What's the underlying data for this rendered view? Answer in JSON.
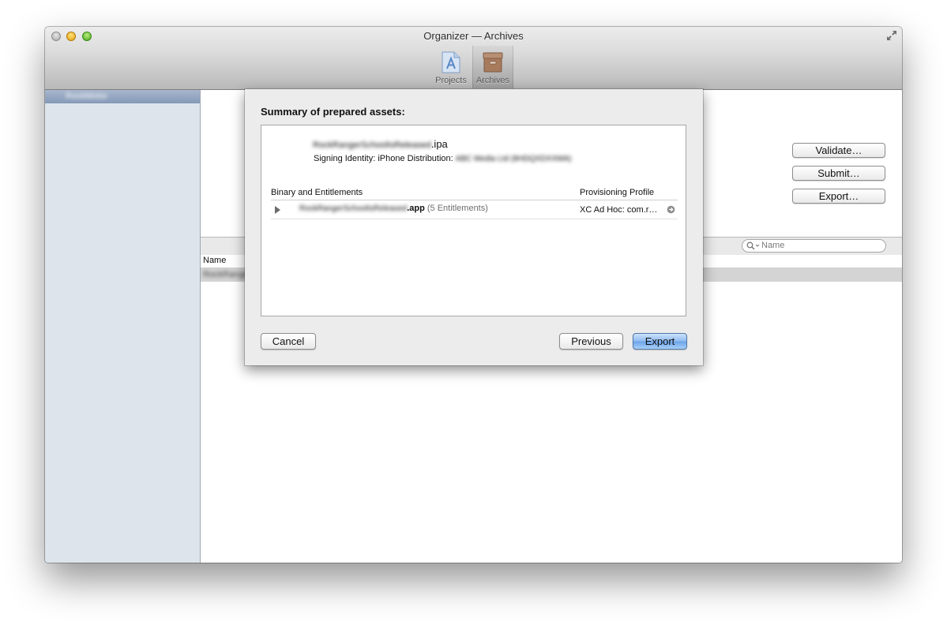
{
  "window": {
    "title": "Organizer — Archives",
    "toolbar": [
      {
        "label": "Projects",
        "icon": "projects-icon",
        "selected": false
      },
      {
        "label": "Archives",
        "icon": "archives-icon",
        "selected": true
      }
    ]
  },
  "sidebar": {
    "selected_item": "RockMotor"
  },
  "main": {
    "buttons": {
      "validate": "Validate…",
      "submit": "Submit…",
      "export": "Export…"
    },
    "search": {
      "placeholder": "Name"
    },
    "column_name": "Name",
    "row_name": "RockRange"
  },
  "sheet": {
    "title": "Summary of prepared assets:",
    "ipa_name_blurred": "RockRangerSchoolIsReleased",
    "ipa_ext": ".ipa",
    "signing_label": "Signing Identity: iPhone Distribution:",
    "signing_value_blurred": "ABC Media Ltd (8HDQXDXXMA)",
    "table_headers": {
      "binary": "Binary and Entitlements",
      "profile": "Provisioning Profile"
    },
    "row": {
      "app_name_blurred": "RockRangerSchoolIsReleased",
      "app_ext": ".app",
      "entitlements": "(5 Entitlements)",
      "profile": "XC Ad Hoc: com.r…"
    },
    "buttons": {
      "cancel": "Cancel",
      "previous": "Previous",
      "export": "Export"
    }
  },
  "colors": {
    "default_button": "#6aa3ea",
    "sidebar_bg": "#dde4ec",
    "sidebar_selection": "#8599b8"
  }
}
